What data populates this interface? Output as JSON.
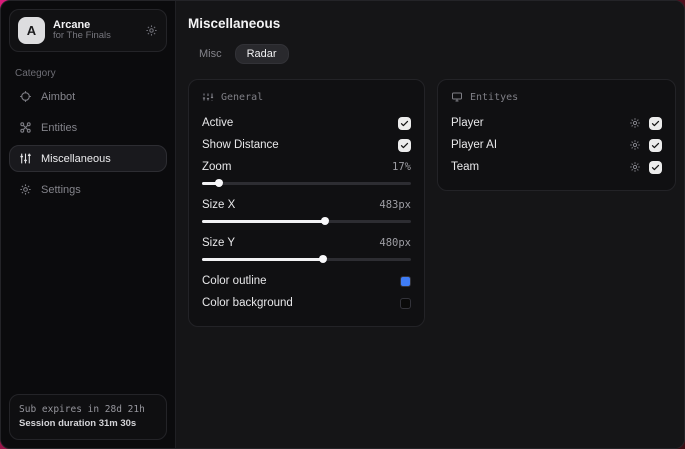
{
  "sidebar": {
    "profile": {
      "initial": "A",
      "name": "Arcane",
      "subtitle": "for The Finals"
    },
    "category_label": "Category",
    "items": [
      {
        "label": "Aimbot",
        "icon": "crosshair-icon",
        "active": false
      },
      {
        "label": "Entities",
        "icon": "entities-icon",
        "active": false
      },
      {
        "label": "Miscellaneous",
        "icon": "sliders-icon",
        "active": true
      },
      {
        "label": "Settings",
        "icon": "gear-icon",
        "active": false
      }
    ],
    "sub_status": {
      "line1": "Sub expires in 28d 21h",
      "line2": "Session duration 31m 30s"
    }
  },
  "main": {
    "title": "Miscellaneous",
    "tabs": [
      {
        "label": "Misc",
        "active": false
      },
      {
        "label": "Radar",
        "active": true
      }
    ],
    "panels": {
      "general": {
        "title": "General",
        "toggles": [
          {
            "label": "Active",
            "checked": true
          },
          {
            "label": "Show Distance",
            "checked": true
          }
        ],
        "sliders": [
          {
            "label": "Zoom",
            "value": "17%",
            "fill_percent": 8
          },
          {
            "label": "Size X",
            "value": "483px",
            "fill_percent": 59
          },
          {
            "label": "Size Y",
            "value": "480px",
            "fill_percent": 58
          }
        ],
        "colors": [
          {
            "label": "Color outline",
            "hex": "#3f7df6"
          },
          {
            "label": "Color background",
            "hex": "#0a0a0a"
          }
        ]
      },
      "entities": {
        "title": "Entityes",
        "rows": [
          {
            "label": "Player",
            "checked": true
          },
          {
            "label": "Player AI",
            "checked": true
          },
          {
            "label": "Team",
            "checked": true
          }
        ]
      }
    }
  }
}
